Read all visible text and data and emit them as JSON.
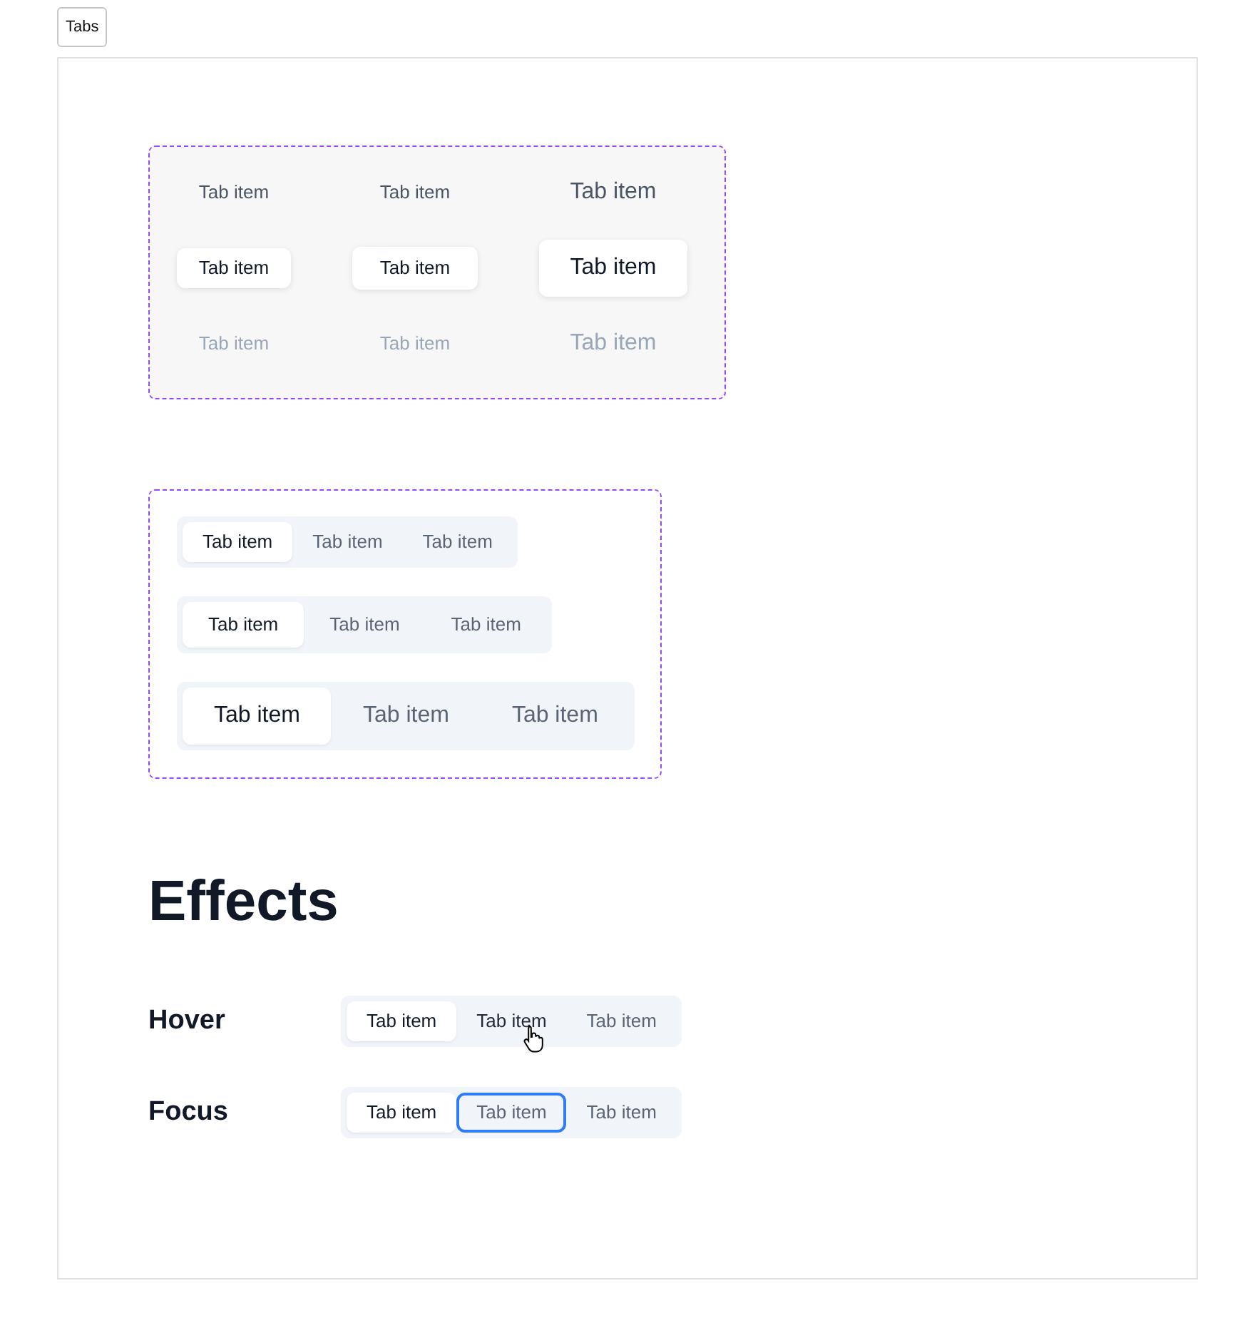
{
  "top_button": "Tabs",
  "states_grid": {
    "columns": [
      {
        "kind": "small",
        "items": [
          {
            "label": "Tab item",
            "selected": false,
            "disabled": false
          },
          {
            "label": "Tab item",
            "selected": true,
            "disabled": false
          },
          {
            "label": "Tab item",
            "selected": false,
            "disabled": true
          }
        ]
      },
      {
        "kind": "medium",
        "items": [
          {
            "label": "Tab item",
            "selected": false,
            "disabled": false
          },
          {
            "label": "Tab item",
            "selected": true,
            "disabled": false
          },
          {
            "label": "Tab item",
            "selected": false,
            "disabled": true
          }
        ]
      },
      {
        "kind": "large",
        "items": [
          {
            "label": "Tab item",
            "selected": false,
            "disabled": false
          },
          {
            "label": "Tab item",
            "selected": true,
            "disabled": false
          },
          {
            "label": "Tab item",
            "selected": false,
            "disabled": true
          }
        ]
      }
    ]
  },
  "tab_groups": [
    {
      "kind": "small",
      "tabs": [
        {
          "label": "Tab item",
          "selected": true
        },
        {
          "label": "Tab item",
          "selected": false
        },
        {
          "label": "Tab item",
          "selected": false
        }
      ]
    },
    {
      "kind": "medium",
      "tabs": [
        {
          "label": "Tab item",
          "selected": true
        },
        {
          "label": "Tab item",
          "selected": false
        },
        {
          "label": "Tab item",
          "selected": false
        }
      ]
    },
    {
      "kind": "large",
      "tabs": [
        {
          "label": "Tab item",
          "selected": true
        },
        {
          "label": "Tab item",
          "selected": false
        },
        {
          "label": "Tab item",
          "selected": false
        }
      ]
    }
  ],
  "effects": {
    "heading": "Effects",
    "rows": [
      {
        "label": "Hover",
        "tabs": [
          {
            "label": "Tab item",
            "selected": true,
            "hovered": false,
            "focused": false
          },
          {
            "label": "Tab item",
            "selected": false,
            "hovered": true,
            "focused": false
          },
          {
            "label": "Tab item",
            "selected": false,
            "hovered": false,
            "focused": false
          }
        ]
      },
      {
        "label": "Focus",
        "tabs": [
          {
            "label": "Tab item",
            "selected": true,
            "hovered": false,
            "focused": false
          },
          {
            "label": "Tab item",
            "selected": false,
            "hovered": false,
            "focused": true
          },
          {
            "label": "Tab item",
            "selected": false,
            "hovered": false,
            "focused": false
          }
        ]
      }
    ]
  }
}
